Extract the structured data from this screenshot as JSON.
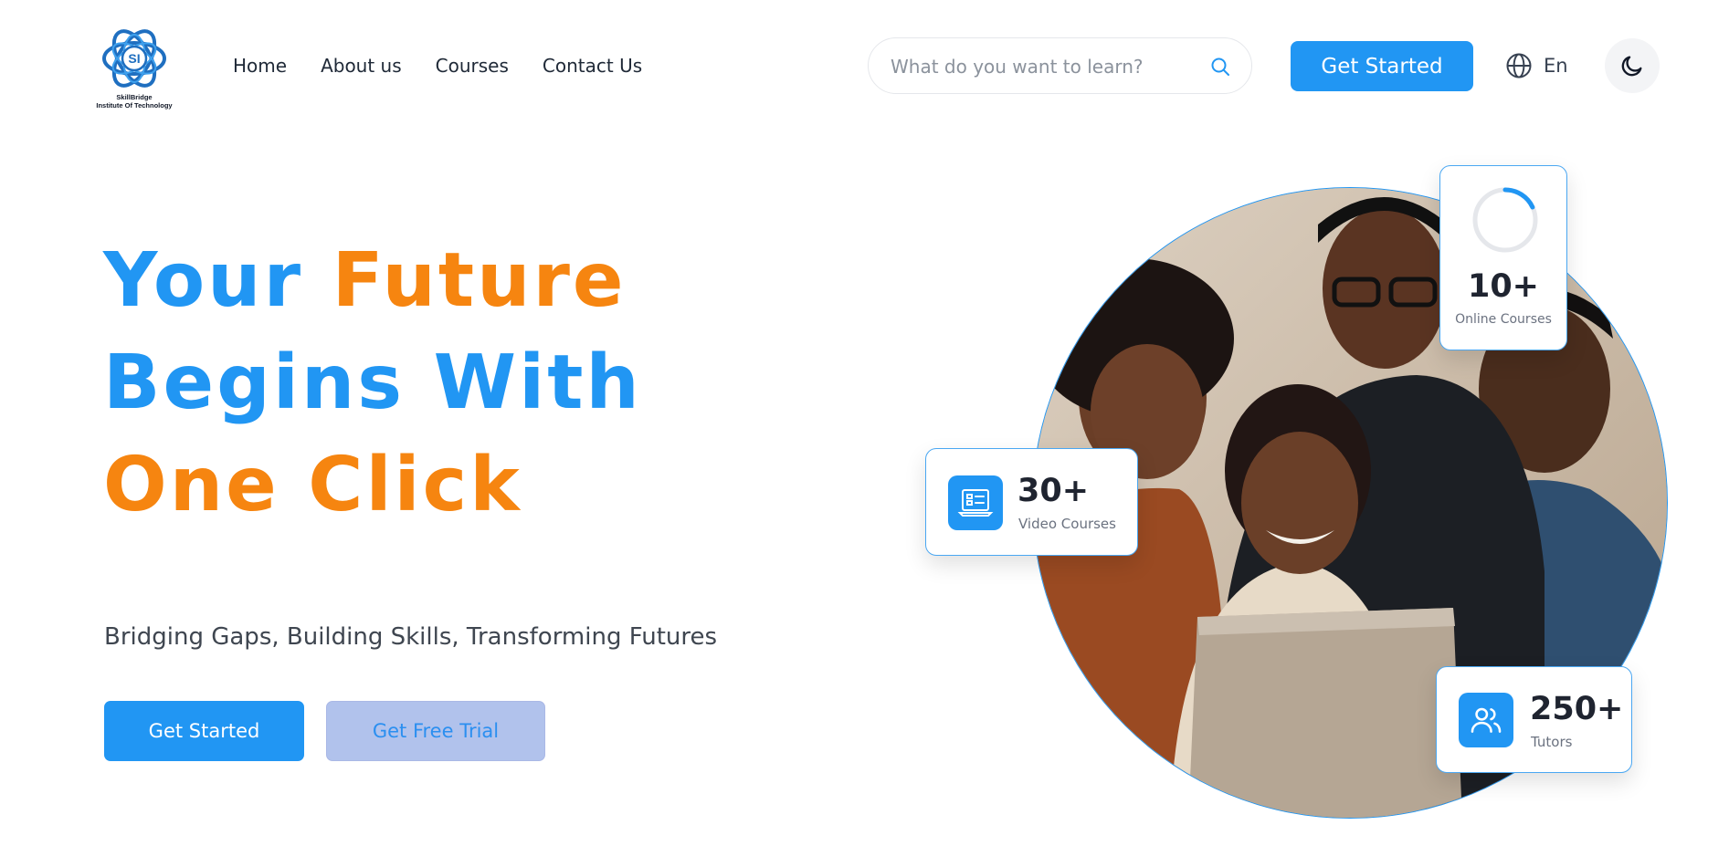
{
  "brand": {
    "name_line1": "SkillBridge",
    "name_line2": "Institute Of Technology",
    "logo_letters": "SI"
  },
  "nav": {
    "items": [
      {
        "label": "Home"
      },
      {
        "label": "About us"
      },
      {
        "label": "Courses"
      },
      {
        "label": "Contact Us"
      }
    ]
  },
  "search": {
    "placeholder": "What do you want to learn?",
    "icon": "search-icon"
  },
  "header": {
    "cta_label": "Get Started",
    "language_label": "En",
    "language_icon": "globe-icon",
    "theme_icon": "moon-icon"
  },
  "hero": {
    "headline": {
      "word1": "Your",
      "word2": "Future",
      "word3": "Begins",
      "word4": "With",
      "word5": "One",
      "word6": "Click"
    },
    "tagline": "Bridging Gaps, Building Skills, Transforming Futures",
    "primary_button": "Get Started",
    "secondary_button": "Get Free Trial"
  },
  "stats": {
    "online": {
      "value": "10+",
      "label": "Online Courses",
      "progress": 0.18
    },
    "video": {
      "value": "30+",
      "label": "Video Courses",
      "icon": "video-course-icon"
    },
    "tutors": {
      "value": "250+",
      "label": "Tutors",
      "icon": "users-icon"
    }
  },
  "colors": {
    "primary": "#2196f3",
    "accent": "#f68510",
    "text": "#1f2937",
    "muted": "#6b7280"
  }
}
